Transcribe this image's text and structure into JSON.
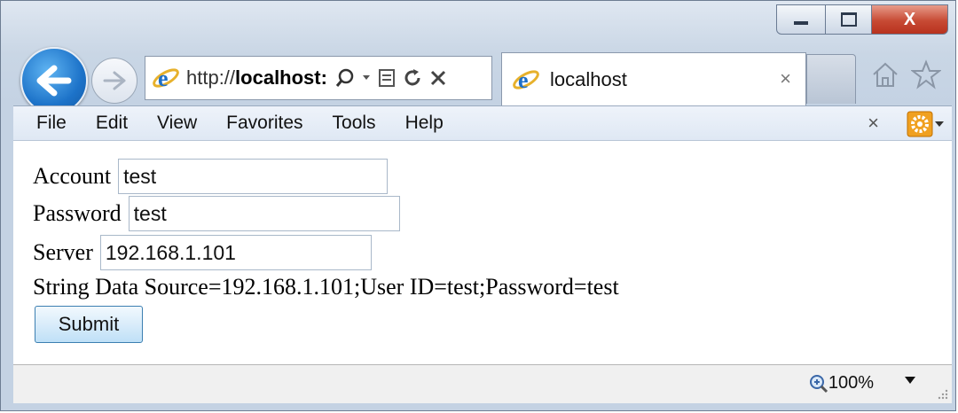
{
  "browser": {
    "address_prefix": "http://",
    "address_host": "localhost:",
    "tab_title": "localhost",
    "tab_close": "×",
    "window_close": "X"
  },
  "menu": {
    "items": [
      "File",
      "Edit",
      "View",
      "Favorites",
      "Tools",
      "Help"
    ],
    "close": "×"
  },
  "form": {
    "account_label": "Account",
    "account_value": "test",
    "password_label": "Password",
    "password_value": "test",
    "server_label": "Server",
    "server_value": "192.168.1.101",
    "connection_string": "String Data Source=192.168.1.101;User ID=test;Password=test",
    "submit_label": "Submit"
  },
  "status": {
    "zoom": "100%"
  },
  "icons": [
    "back-icon",
    "forward-icon",
    "ie-logo-icon",
    "search-icon",
    "compat-view-icon",
    "refresh-icon",
    "stop-icon",
    "home-icon",
    "favorites-star-icon",
    "gear-icon",
    "zoom-icon"
  ],
  "colors": {
    "accent": "#1d73c9",
    "close": "#c74a34",
    "gear": "#f0a020"
  }
}
